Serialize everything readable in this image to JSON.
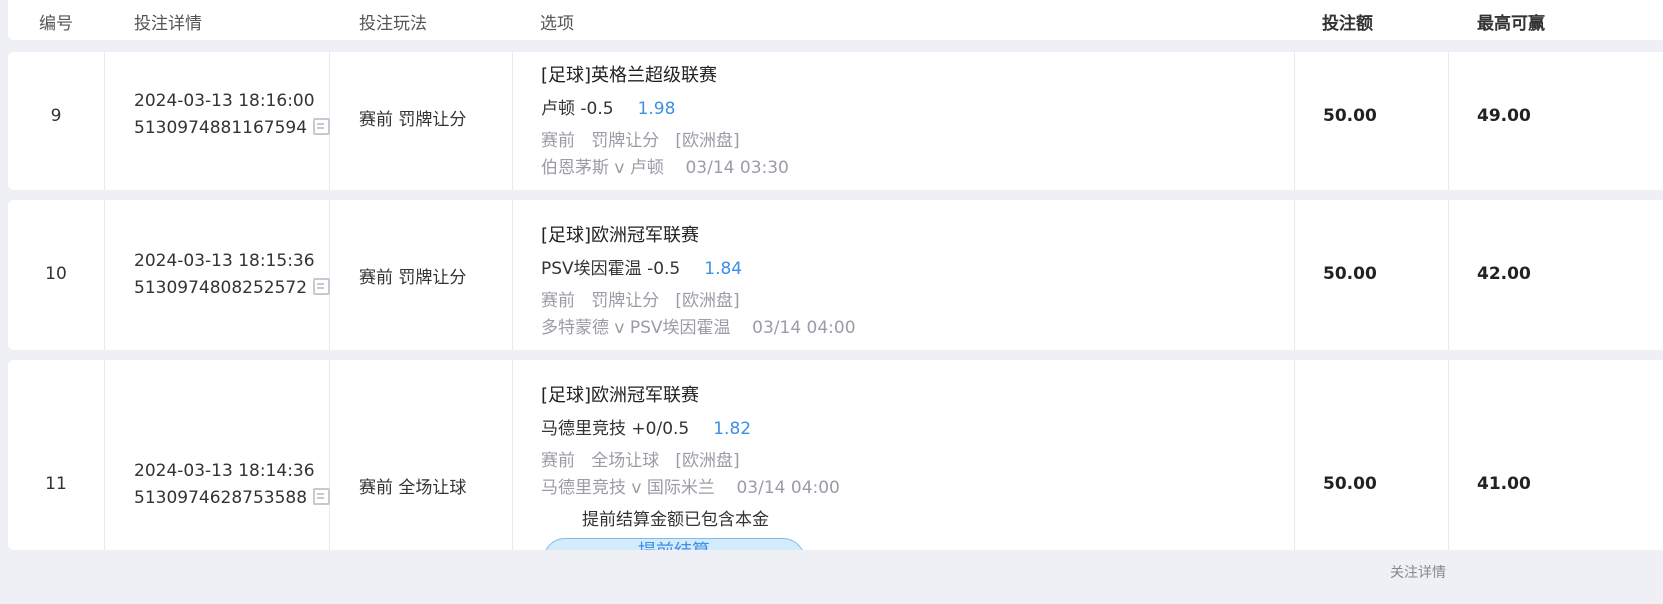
{
  "header": {
    "col_no": "编号",
    "col_detail": "投注详情",
    "col_play": "投注玩法",
    "col_option": "选项",
    "col_stake": "投注额",
    "col_maxwin": "最高可赢"
  },
  "rows": [
    {
      "no": "9",
      "datetime": "2024-03-13 18:16:00",
      "order_id": "5130974881167594",
      "play": "赛前 罚牌让分",
      "league": "[足球]英格兰超级联赛",
      "selection": "卢顿 -0.5",
      "odds": "1.98",
      "market": "赛前   罚牌让分   [欧洲盘]",
      "match": "伯恩茅斯 v 卢顿    03/14 03:30",
      "stake": "50.00",
      "max_win": "49.00"
    },
    {
      "no": "10",
      "datetime": "2024-03-13 18:15:36",
      "order_id": "5130974808252572",
      "play": "赛前 罚牌让分",
      "league": "[足球]欧洲冠军联赛",
      "selection": "PSV埃因霍温 -0.5",
      "odds": "1.84",
      "market": "赛前   罚牌让分   [欧洲盘]",
      "match": "多特蒙德 v PSV埃因霍温    03/14 04:00",
      "stake": "50.00",
      "max_win": "42.00"
    },
    {
      "no": "11",
      "datetime": "2024-03-13 18:14:36",
      "order_id": "5130974628753588",
      "play": "赛前 全场让球",
      "league": "[足球]欧洲冠军联赛",
      "selection": "马德里竞技 +0/0.5",
      "odds": "1.82",
      "market": "赛前   全场让球   [欧洲盘]",
      "match": "马德里竞技 v 国际米兰    03/14 04:00",
      "settle_note": "提前结算金额已包含本金",
      "settle_button": "提前结算",
      "stake": "50.00",
      "max_win": "41.00"
    }
  ],
  "footer": {
    "hint": "关注详情"
  },
  "icons": {
    "copy": "copy-icon"
  },
  "colors": {
    "odds_blue": "#3d8fe8",
    "gray_text": "#9a9ca6",
    "page_bg": "#eef0f6",
    "button_bg": "#d4ebfb"
  }
}
